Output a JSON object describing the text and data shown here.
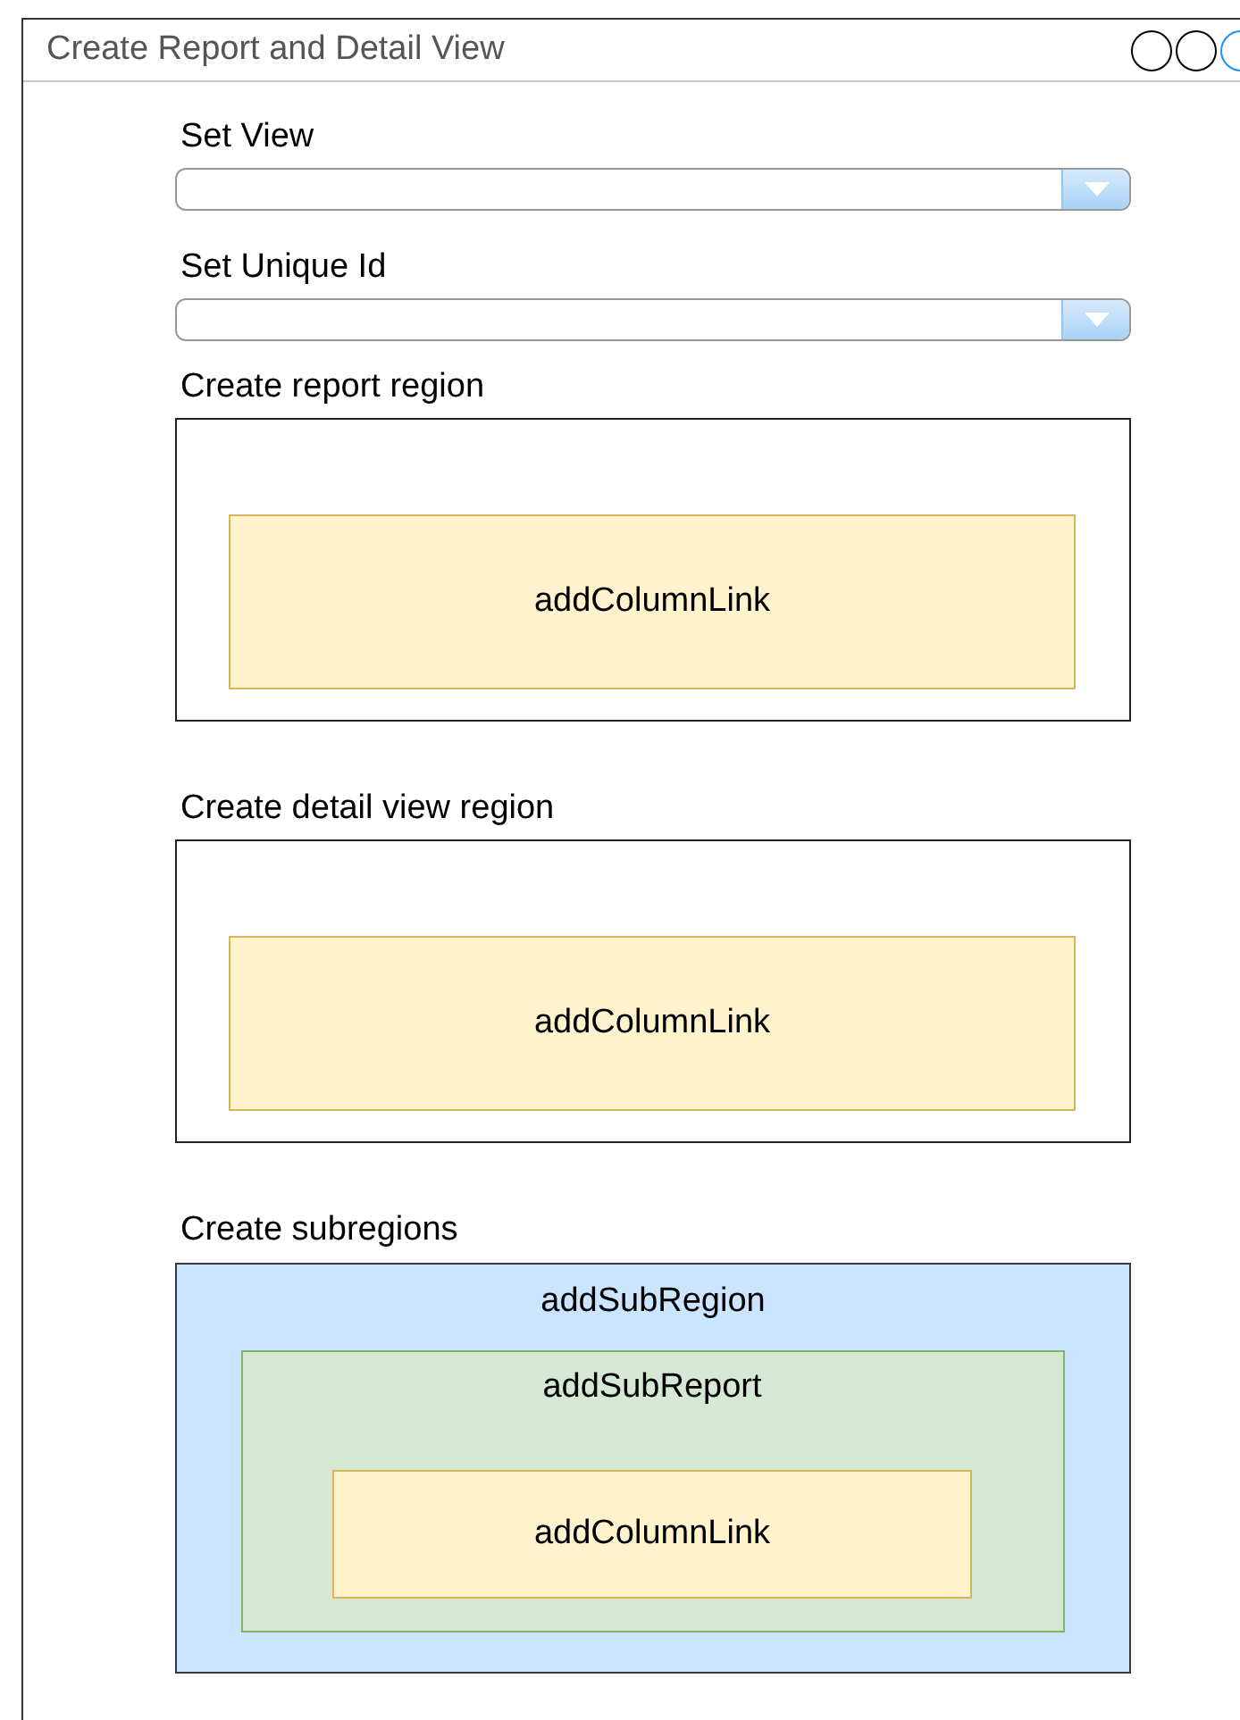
{
  "window": {
    "title": "Create Report and Detail View",
    "buttons": [
      {
        "color": "#000000"
      },
      {
        "color": "#000000"
      },
      {
        "color": "#1e90ff"
      }
    ]
  },
  "fields": [
    {
      "label": "Set View"
    },
    {
      "label": "Set Unique Id"
    }
  ],
  "regions": [
    {
      "kind": "region",
      "label": "Create report region",
      "inner": "addColumnLink"
    },
    {
      "kind": "region",
      "label": "Create detail view region",
      "inner": "addColumnLink"
    },
    {
      "kind": "nested",
      "label": "Create subregions",
      "outer": "addSubRegion",
      "middle": "addSubReport",
      "inner": "addColumnLink"
    }
  ]
}
